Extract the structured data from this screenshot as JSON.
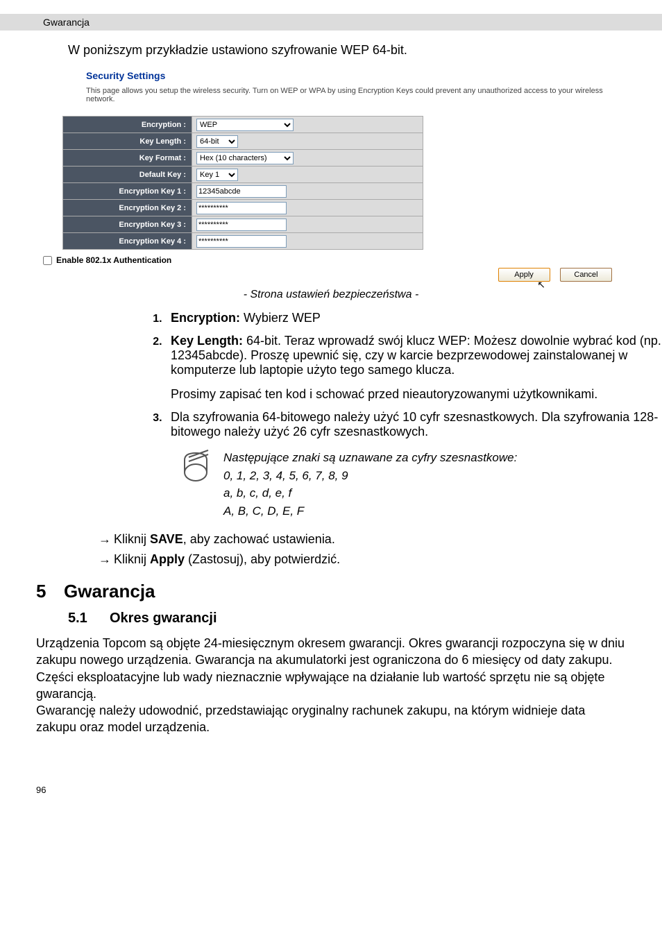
{
  "header": {
    "running_title": "Gwarancja"
  },
  "intro": "W poniższym przykładzie ustawiono szyfrowanie WEP 64-bit.",
  "security": {
    "heading": "Security Settings",
    "description": "This page allows you setup the wireless security. Turn on WEP or WPA by using Encryption Keys could prevent any unauthorized access to your wireless network.",
    "rows": {
      "encryption_label": "Encryption :",
      "encryption_value": "WEP",
      "keylength_label": "Key Length :",
      "keylength_value": "64-bit",
      "keyformat_label": "Key Format :",
      "keyformat_value": "Hex (10 characters)",
      "defaultkey_label": "Default Key :",
      "defaultkey_value": "Key 1",
      "ek1_label": "Encryption Key 1 :",
      "ek1_value": "12345abcde",
      "ek2_label": "Encryption Key 2 :",
      "ek2_value": "**********",
      "ek3_label": "Encryption Key 3 :",
      "ek3_value": "**********",
      "ek4_label": "Encryption Key 4 :",
      "ek4_value": "**********"
    },
    "enable_8021x": "Enable 802.1x Authentication",
    "apply": "Apply",
    "cancel": "Cancel"
  },
  "caption": "- Strona ustawień bezpieczeństwa -",
  "steps": {
    "s1_bold": "Encryption:",
    "s1_rest": " Wybierz WEP",
    "s2_bold": "Key Length:",
    "s2_rest": " 64-bit. Teraz wprowadź swój klucz WEP: Możesz dowolnie wybrać kod (np. 12345abcde). Proszę upewnić się, czy w karcie bezprzewodowej zainstalowanej w komputerze lub laptopie użyto tego samego klucza.",
    "s2_sub": "Prosimy zapisać ten kod i schować przed nieautoryzowanymi użytkownikami.",
    "s3": "Dla szyfrowania 64-bitowego należy użyć 10 cyfr szesnastkowych. Dla szyfrowania 128-bitowego należy użyć 26 cyfr szesnastkowych."
  },
  "note": {
    "line1": "Następujące znaki są uznawane za cyfry szesnastkowe:",
    "line2": "0, 1, 2, 3, 4, 5, 6, 7, 8, 9",
    "line3": " a, b, c, d, e, f",
    "line4": "A, B, C, D, E, F"
  },
  "arrows": {
    "a1_pre": "Kliknij ",
    "a1_bold": "SAVE",
    "a1_post": ", aby zachować ustawienia.",
    "a2_pre": "Kliknij ",
    "a2_bold": "Apply",
    "a2_post": " (Zastosuj), aby potwierdzić."
  },
  "section5": {
    "num": "5",
    "title": "Gwarancja",
    "sub_num": "5.1",
    "sub_title": "Okres gwarancji",
    "body": "Urządzenia Topcom są objęte 24-miesięcznym okresem gwarancji. Okres gwarancji rozpoczyna się w dniu zakupu nowego urządzenia. Gwarancja na akumulatorki jest ograniczona do 6 miesięcy od daty zakupu. Części eksploatacyjne lub wady nieznacznie wpływające na działanie lub wartość sprzętu nie są objęte gwarancją.\nGwarancję należy udowodnić, przedstawiając oryginalny rachunek zakupu, na którym widnieje data zakupu oraz model urządzenia."
  },
  "page_number": "96"
}
